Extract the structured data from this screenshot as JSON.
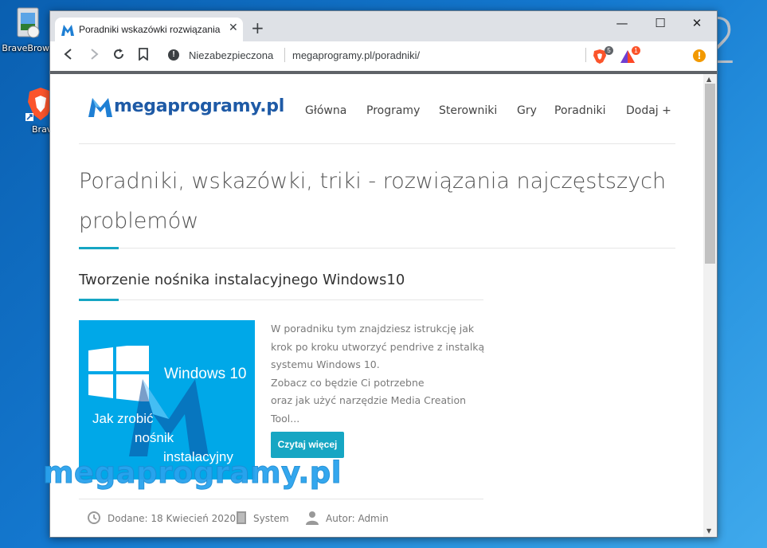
{
  "desktop": {
    "icons": [
      {
        "label": "BraveBrows",
        "icon": "brave-installer-icon"
      },
      {
        "label": "Brav",
        "icon": "brave-shortcut-icon"
      }
    ],
    "overlay_number": "2",
    "watermark": "megaprogramy.pl"
  },
  "browser": {
    "tab": {
      "title": "Poradniki wskazówki rozwiązania n",
      "favicon": "megaprogramy-favicon",
      "close": "✕"
    },
    "new_tab": "+",
    "window_controls": {
      "minimize": "—",
      "maximize": "☐",
      "close": "✕"
    },
    "toolbar": {
      "back": "‹",
      "forward": "›",
      "reload": "↻",
      "bookmark": "bookmark-icon",
      "security_label": "Niezabezpieczona",
      "url": "megaprogramy.pl/poradniki/",
      "brave_shields_count": "5",
      "brave_rewards_count": "1",
      "alert": "!"
    }
  },
  "site": {
    "logo": "megaprogramy.pl",
    "nav": [
      "Główna",
      "Programy",
      "Sterowniki",
      "Gry",
      "Poradniki",
      "Dodaj +"
    ],
    "heading_line1": "Poradniki, wskazówki, triki - rozwiązania najczęstszych",
    "heading_line2": "problemów",
    "post": {
      "title": "Tworzenie nośnika instalacyjnego Windows10",
      "thumbnail": {
        "brand": "Windows 10",
        "line1": "Jak zrobić",
        "line2": "nośnik",
        "line3": "instalacyjny"
      },
      "excerpt": [
        "W poradniku tym znajdziesz istrukcję jak",
        "krok po kroku utworzyć pendrive z instalką",
        "systemu Windows 10.",
        "Zobacz co będzie Ci potrzebne",
        "oraz jak użyć narzędzie Media Creation",
        "Tool..."
      ],
      "read_more": "Czytaj więcej",
      "meta": {
        "date": "Dodane: 18 Kwiecień 2020",
        "category": "System",
        "author": "Autor: Admin"
      }
    }
  },
  "colors": {
    "accent": "#16a6c3",
    "logo": "#1e5aa6",
    "thumbnail_bg": "#00a8e8",
    "watermark": "#2aa3ee"
  }
}
